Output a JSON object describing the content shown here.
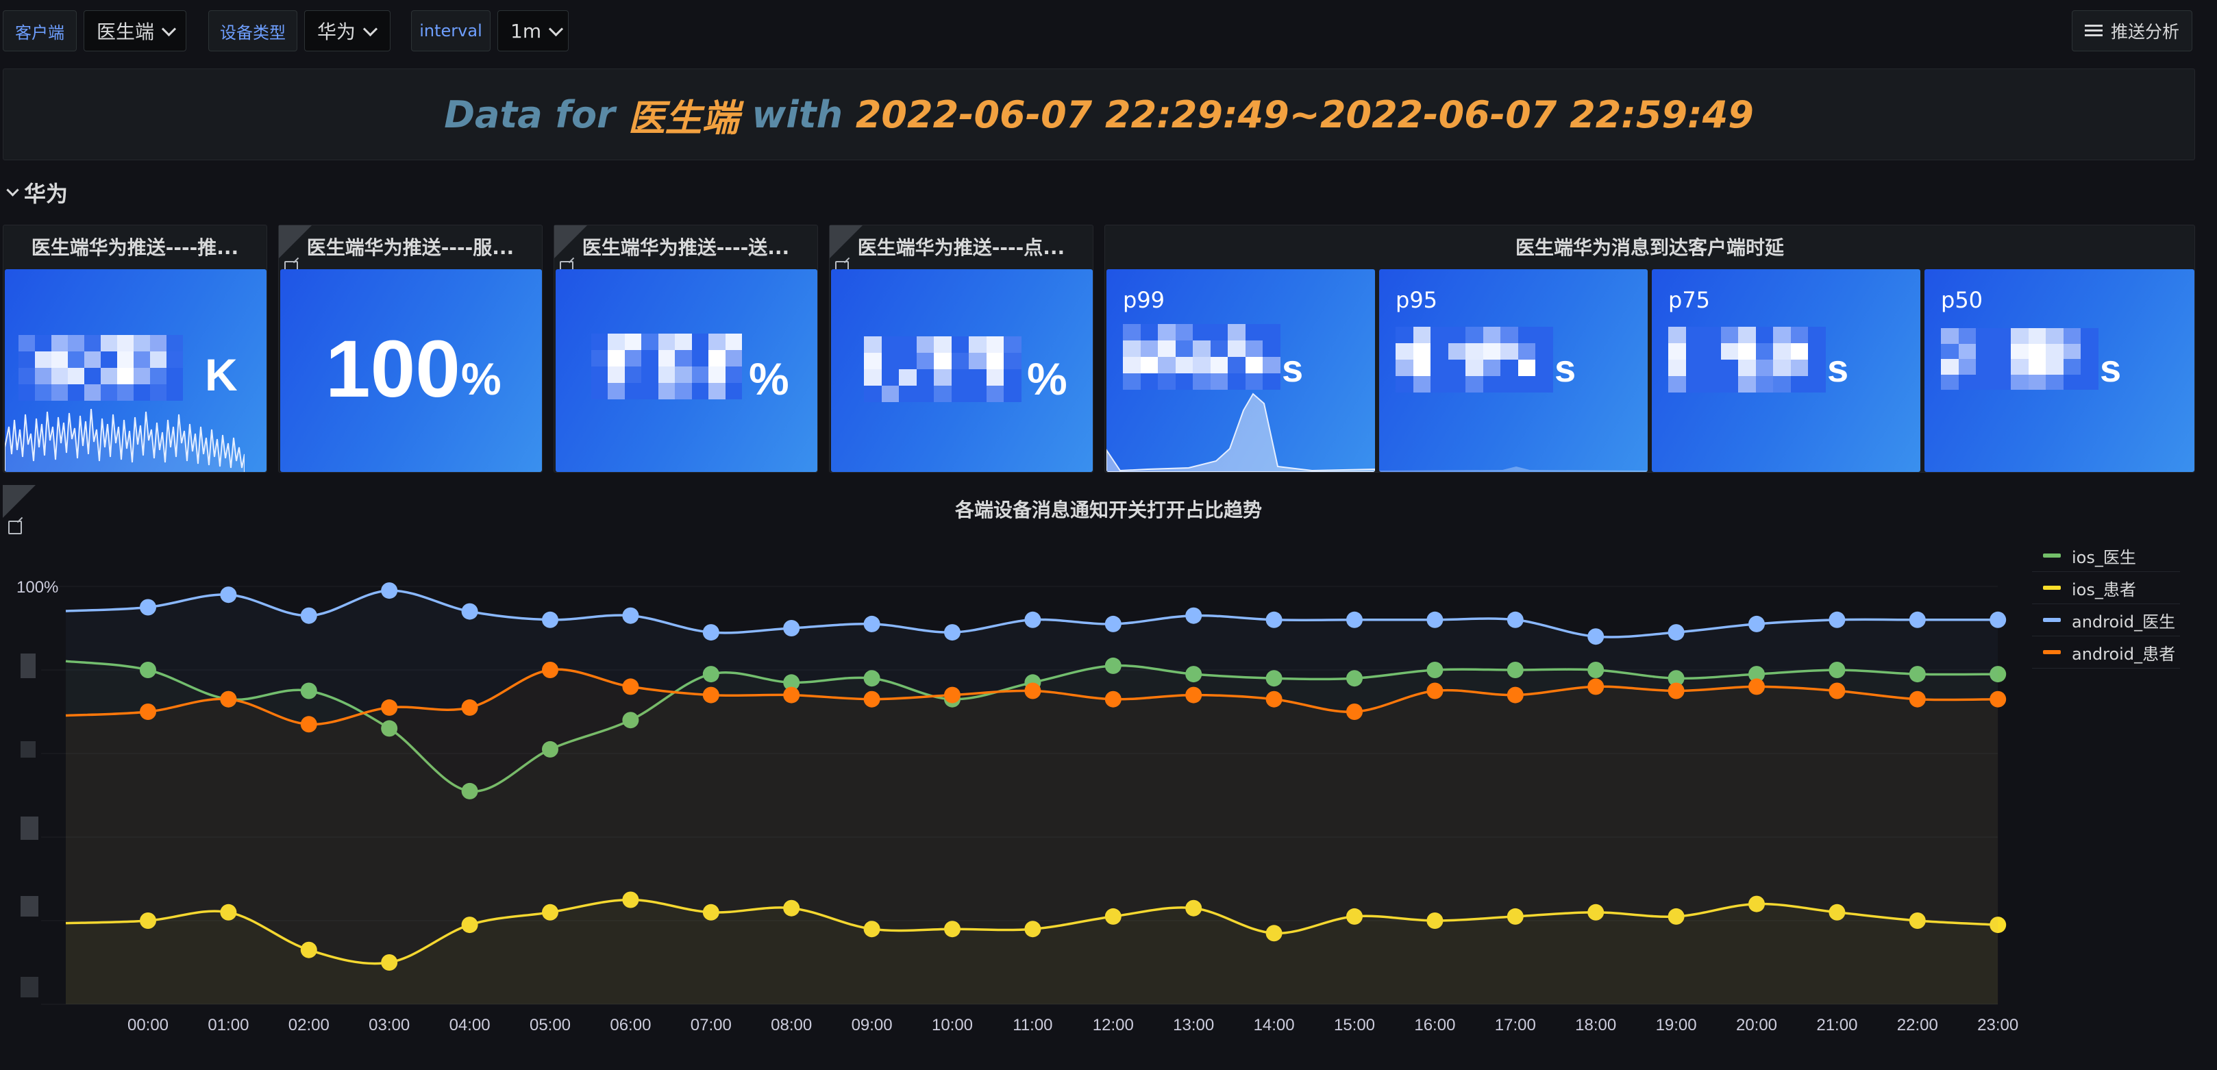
{
  "variables": [
    {
      "label": "客户端",
      "value": "医生端"
    },
    {
      "label": "设备类型",
      "value": "华为"
    },
    {
      "label": "interval",
      "value": "1m"
    }
  ],
  "push_button": {
    "label": "推送分析",
    "icon": "hamburger-icon"
  },
  "banner": {
    "prefix": "Data for",
    "client": "医生端",
    "mid": "with",
    "range": "2022-06-07 22:29:49~2022-06-07 22:59:49"
  },
  "row": {
    "title": "华为"
  },
  "stats": [
    {
      "title": "医生端华为推送----推...",
      "unit": "K",
      "value_obscured": true
    },
    {
      "title": "医生端华为推送----服...",
      "value": "100",
      "unit": "%"
    },
    {
      "title": "医生端华为推送----送...",
      "unit": "%",
      "value_obscured": true
    },
    {
      "title": "医生端华为推送----点...",
      "unit": "%",
      "value_obscured": true
    }
  ],
  "latency_panel": {
    "title": "医生端华为消息到达客户端时延",
    "cells": [
      {
        "label": "p99",
        "unit": "s"
      },
      {
        "label": "p95",
        "unit": "s"
      },
      {
        "label": "p75",
        "unit": "s"
      },
      {
        "label": "p50",
        "unit": "s"
      }
    ]
  },
  "colors": {
    "ios_doctor": "#73bf69",
    "ios_patient": "#fade2a",
    "android_doctor": "#8ab8ff",
    "android_patient": "#ff780a",
    "stat_bg": "#1f60e4",
    "banner_prefix": "#5a8aa6",
    "banner_value": "#f2a140"
  },
  "chart_data": {
    "type": "line",
    "title": "各端设备消息通知开关打开占比趋势",
    "x": [
      "00:00",
      "01:00",
      "02:00",
      "03:00",
      "04:00",
      "05:00",
      "06:00",
      "07:00",
      "08:00",
      "09:00",
      "10:00",
      "11:00",
      "12:00",
      "13:00",
      "14:00",
      "15:00",
      "16:00",
      "17:00",
      "18:00",
      "19:00",
      "20:00",
      "21:00",
      "22:00",
      "23:00"
    ],
    "y_tick_labels": [
      "100%"
    ],
    "ylim": [
      0,
      100
    ],
    "legend_position": "top-right",
    "series": [
      {
        "name": "ios_医生",
        "color": "#73bf69",
        "values": [
          80,
          73,
          75,
          66,
          51,
          61,
          68,
          79,
          77,
          78,
          73,
          77,
          81,
          79,
          78,
          78,
          80,
          80,
          80,
          78,
          79,
          80,
          79,
          79
        ]
      },
      {
        "name": "ios_患者",
        "color": "#fade2a",
        "values": [
          20,
          22,
          13,
          10,
          19,
          22,
          25,
          22,
          23,
          18,
          18,
          18,
          21,
          23,
          17,
          21,
          20,
          21,
          22,
          21,
          24,
          22,
          20,
          19
        ]
      },
      {
        "name": "android_医生",
        "color": "#8ab8ff",
        "values": [
          95,
          98,
          93,
          99,
          94,
          92,
          93,
          89,
          90,
          91,
          89,
          92,
          91,
          93,
          92,
          92,
          92,
          92,
          88,
          89,
          91,
          92,
          92,
          92
        ]
      },
      {
        "name": "android_患者",
        "color": "#ff780a",
        "values": [
          70,
          73,
          67,
          71,
          71,
          80,
          76,
          74,
          74,
          73,
          74,
          75,
          73,
          74,
          73,
          70,
          75,
          74,
          76,
          75,
          76,
          75,
          73,
          73
        ]
      }
    ]
  }
}
